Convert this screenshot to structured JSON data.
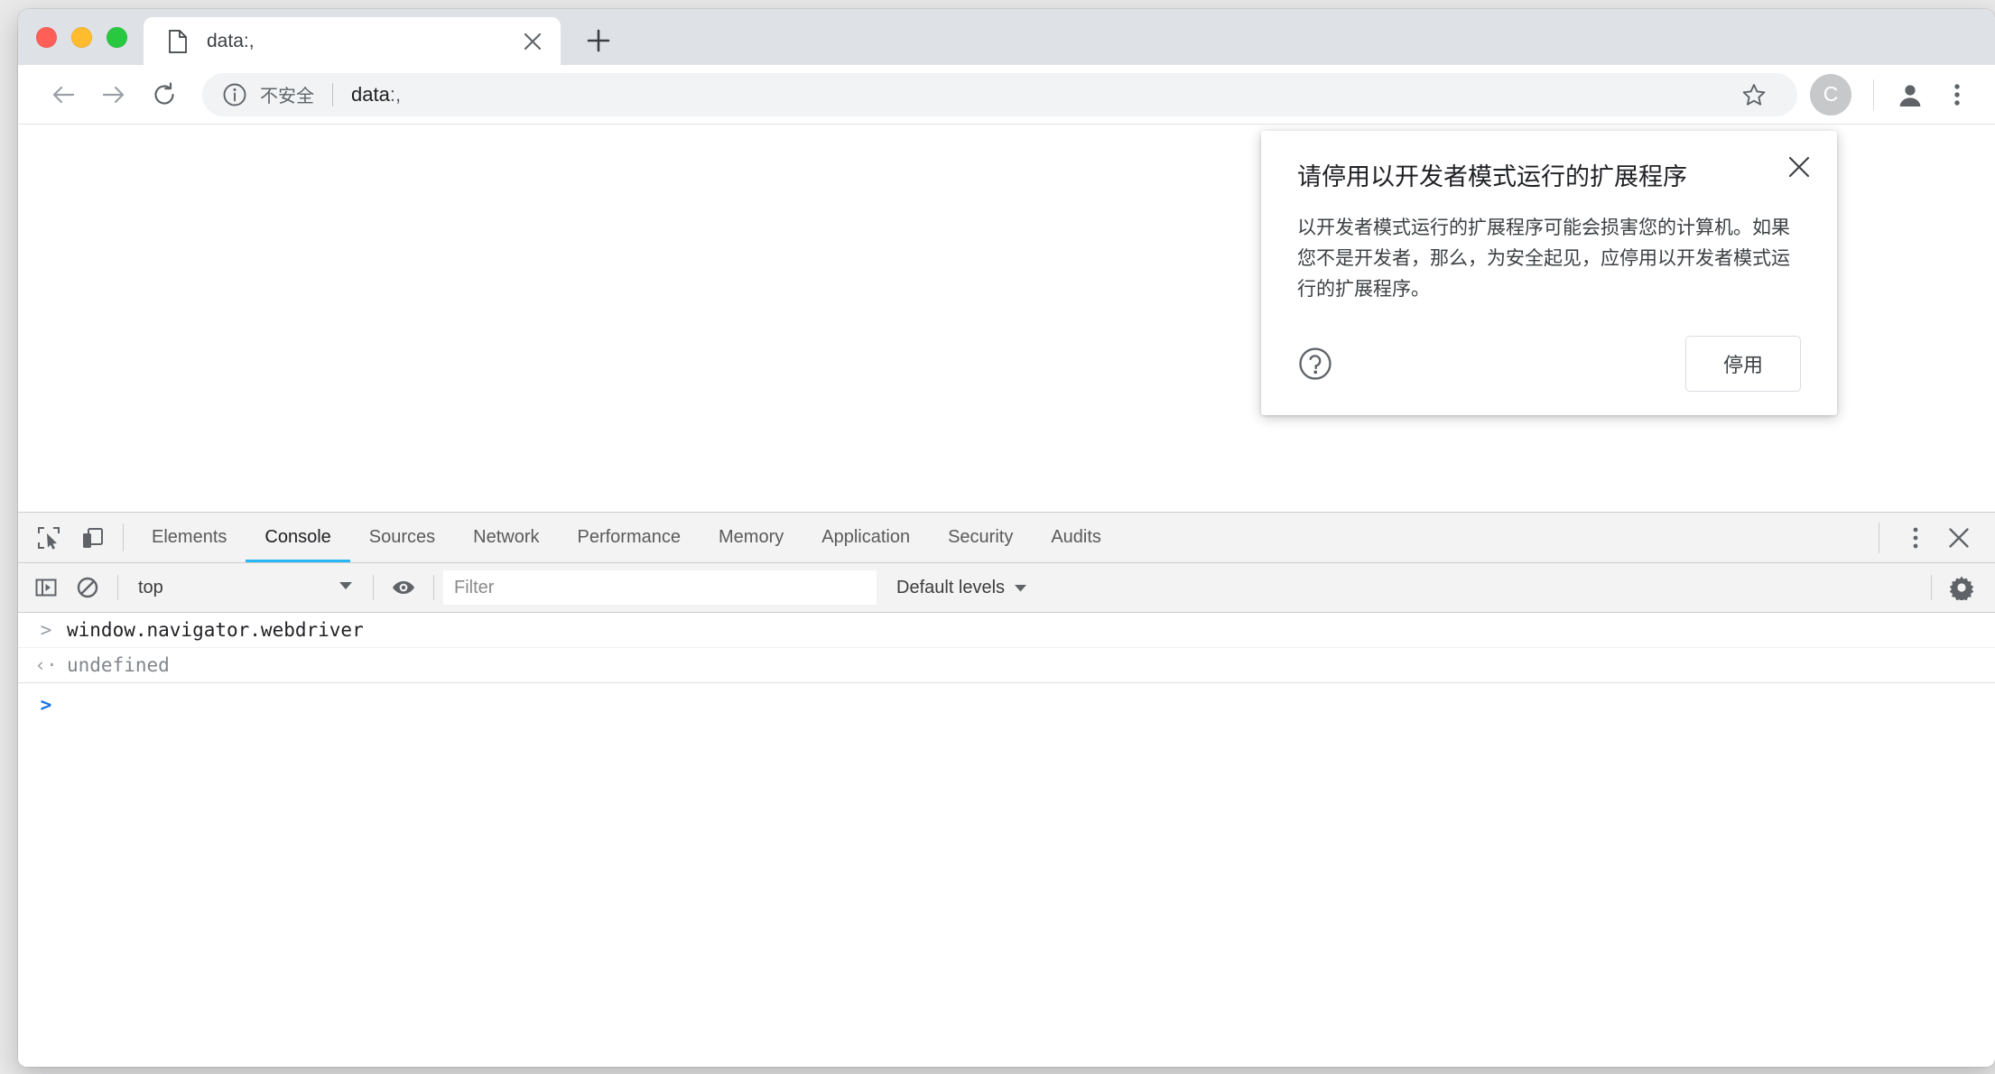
{
  "browser": {
    "window_controls": [
      "close",
      "minimize",
      "zoom"
    ],
    "tab": {
      "favicon": "page-icon",
      "title": "data:,",
      "close_icon": "close-icon"
    },
    "new_tab_label": "+",
    "toolbar": {
      "back_icon": "back-arrow-icon",
      "forward_icon": "forward-arrow-icon",
      "reload_icon": "reload-icon",
      "info_icon": "info-circle-icon",
      "security_text": "不安全",
      "url_main": "data",
      "url_suffix": ":,",
      "bookmark_icon": "star-icon",
      "extension_badge": "C",
      "profile_icon": "account-avatar-icon",
      "menu_icon": "three-dot-menu-icon"
    }
  },
  "dialog": {
    "title": "请停用以开发者模式运行的扩展程序",
    "body": "以开发者模式运行的扩展程序可能会损害您的计算机。如果您不是开发者，那么，为安全起见，应停用以开发者模式运行的扩展程序。",
    "help_icon": "help-circle-icon",
    "close_icon": "close-icon",
    "primary_button": "停用"
  },
  "devtools": {
    "inspect_icon": "inspect-element-icon",
    "device_icon": "device-toolbar-icon",
    "tabs": [
      {
        "label": "Elements",
        "active": false
      },
      {
        "label": "Console",
        "active": true
      },
      {
        "label": "Sources",
        "active": false
      },
      {
        "label": "Network",
        "active": false
      },
      {
        "label": "Performance",
        "active": false
      },
      {
        "label": "Memory",
        "active": false
      },
      {
        "label": "Application",
        "active": false
      },
      {
        "label": "Security",
        "active": false
      },
      {
        "label": "Audits",
        "active": false
      }
    ],
    "active_tab_underline_color": "#29b6f6",
    "more_icon": "three-dot-menu-icon",
    "close_icon": "close-icon",
    "filterbar": {
      "sidebar_icon": "console-sidebar-icon",
      "clear_icon": "clear-console-icon",
      "context": "top",
      "context_caret": "▼",
      "eye_icon": "live-expression-icon",
      "filter_placeholder": "Filter",
      "filter_value": "",
      "levels_label": "Default levels",
      "levels_caret": "▼",
      "settings_icon": "gear-icon"
    },
    "console_rows": [
      {
        "kind": "input",
        "arrow": ">",
        "text": "window.navigator.webdriver"
      },
      {
        "kind": "output",
        "arrow": "‹·",
        "text": "undefined"
      },
      {
        "kind": "prompt",
        "arrow": ">",
        "text": ""
      }
    ]
  },
  "colors": {
    "tabstrip_bg": "#dee1e6",
    "omnibox_bg": "#f1f3f4",
    "devtools_bg": "#f3f3f3",
    "accent_blue": "#29b6f6",
    "prompt_blue": "#1a73e8"
  }
}
